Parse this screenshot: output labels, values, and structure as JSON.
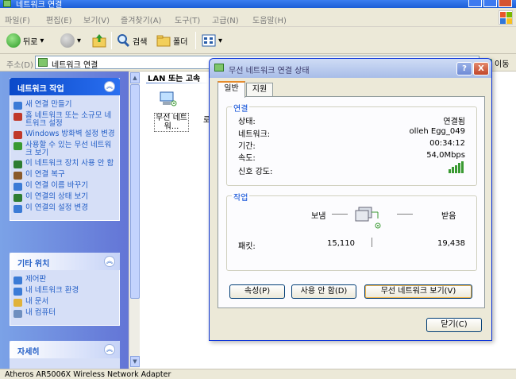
{
  "window": {
    "title": "네트워크 연결",
    "menu": [
      "파일(F)",
      "편집(E)",
      "보기(V)",
      "즐겨찾기(A)",
      "도구(T)",
      "고급(N)",
      "도움말(H)"
    ]
  },
  "toolbar": {
    "back_label": "뒤로",
    "search_label": "검색",
    "folders_label": "폴더"
  },
  "address": {
    "label": "주소(D)",
    "value": "네트워크 연결",
    "go_label": "이동"
  },
  "network_tasks": {
    "header": "네트워크 작업",
    "items": [
      {
        "label": "새 연결 만들기",
        "color": "#3b7bd6"
      },
      {
        "label": "홈 네트워크 또는 소규모 네트워크 설정",
        "color": "#c0392b"
      },
      {
        "label": "Windows 방화벽 설정 변경",
        "color": "#c0392b"
      },
      {
        "label": "사용할 수 있는 무선 네트워크 보기",
        "color": "#3a9a32"
      },
      {
        "label": "이 네트워크 장치 사용 안 함",
        "color": "#2e7d32"
      },
      {
        "label": "이 연결 복구",
        "color": "#8a5a2b"
      },
      {
        "label": "이 연결 이름 바꾸기",
        "color": "#3b7bd6"
      },
      {
        "label": "이 연결의 상태 보기",
        "color": "#2e7d32"
      },
      {
        "label": "이 연결의 설정 변경",
        "color": "#3b7bd6"
      }
    ]
  },
  "other_places": {
    "header": "기타 위치",
    "items": [
      {
        "label": "제어판",
        "color": "#3b7bd6"
      },
      {
        "label": "내 네트워크 환경",
        "color": "#3b7bd6"
      },
      {
        "label": "내 문서",
        "color": "#e0b23a"
      },
      {
        "label": "내 컴퓨터",
        "color": "#6f8fbf"
      }
    ]
  },
  "details": {
    "header": "자세히"
  },
  "content": {
    "group_title": "LAN 또는 고속",
    "connection_label": "무선 네트워...",
    "partial_label": "로"
  },
  "statusbar": {
    "text": "Atheros AR5006X Wireless Network Adapter"
  },
  "dialog": {
    "title": "무선 네트워크 연결 상태",
    "help": "?",
    "close": "X",
    "tabs": [
      "일반",
      "지원"
    ],
    "connection": {
      "section": "연결",
      "rows": [
        {
          "label": "상태:",
          "value": "연결됨"
        },
        {
          "label": "네트워크:",
          "value": "olleh Egg_049"
        },
        {
          "label": "기간:",
          "value": "00:34:12"
        },
        {
          "label": "속도:",
          "value": "54,0Mbps"
        }
      ],
      "signal_label": "신호 강도:",
      "signal_level": 5,
      "signal_max": 5
    },
    "activity": {
      "section": "작업",
      "sent_label": "보냄",
      "received_label": "받음",
      "packets_label": "패킷:",
      "sent_value": "15,110",
      "received_value": "19,438"
    },
    "buttons": {
      "properties": "속성(P)",
      "disable": "사용 안 함(D)",
      "view_wireless": "무선 네트워크 보기(V)",
      "close": "닫기(C)"
    }
  }
}
